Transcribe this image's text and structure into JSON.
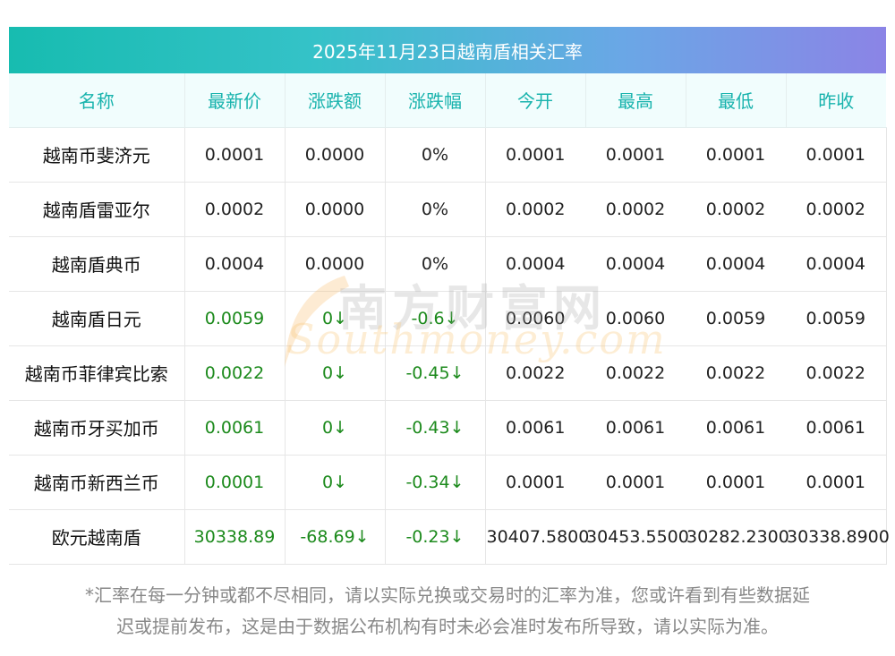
{
  "title": "2025年11月23日越南盾相关汇率",
  "headers": [
    "名称",
    "最新价",
    "涨跌额",
    "涨跌幅",
    "今开",
    "最高",
    "最低",
    "昨收"
  ],
  "rows": [
    {
      "name": "越南币斐济元",
      "latest": "0.0001",
      "change": "0.0000",
      "pct": "0%",
      "open": "0.0001",
      "high": "0.0001",
      "low": "0.0001",
      "prev": "0.0001",
      "down": false
    },
    {
      "name": "越南盾雷亚尔",
      "latest": "0.0002",
      "change": "0.0000",
      "pct": "0%",
      "open": "0.0002",
      "high": "0.0002",
      "low": "0.0002",
      "prev": "0.0002",
      "down": false
    },
    {
      "name": "越南盾典币",
      "latest": "0.0004",
      "change": "0.0000",
      "pct": "0%",
      "open": "0.0004",
      "high": "0.0004",
      "low": "0.0004",
      "prev": "0.0004",
      "down": false
    },
    {
      "name": "越南盾日元",
      "latest": "0.0059",
      "change": "0↓",
      "pct": "-0.6↓",
      "open": "0.0060",
      "high": "0.0060",
      "low": "0.0059",
      "prev": "0.0059",
      "down": true
    },
    {
      "name": "越南币菲律宾比索",
      "latest": "0.0022",
      "change": "0↓",
      "pct": "-0.45↓",
      "open": "0.0022",
      "high": "0.0022",
      "low": "0.0022",
      "prev": "0.0022",
      "down": true
    },
    {
      "name": "越南币牙买加币",
      "latest": "0.0061",
      "change": "0↓",
      "pct": "-0.43↓",
      "open": "0.0061",
      "high": "0.0061",
      "low": "0.0061",
      "prev": "0.0061",
      "down": true
    },
    {
      "name": "越南币新西兰币",
      "latest": "0.0001",
      "change": "0↓",
      "pct": "-0.34↓",
      "open": "0.0001",
      "high": "0.0001",
      "low": "0.0001",
      "prev": "0.0001",
      "down": true
    },
    {
      "name": "欧元越南盾",
      "latest": "30338.89",
      "change": "-68.69↓",
      "pct": "-0.23↓",
      "open": "30407.5800",
      "high": "30453.5500",
      "low": "30282.2300",
      "prev": "30338.8900",
      "down": true
    }
  ],
  "watermark": {
    "cn": "南方财富网",
    "en": "Southmoney.com"
  },
  "footnote_line1": "*汇率在每一分钟或都不尽相同，请以实际兑换或交易时的汇率为准，您或许看到有些数据延",
  "footnote_line2": "迟或提前发布，这是由于数据公布机构有时未必会准时发布所导致，请以实际为准。",
  "colors": {
    "accent": "#18b3ad",
    "down": "#1c8a1c",
    "header_bg": "#f1fdfd"
  }
}
